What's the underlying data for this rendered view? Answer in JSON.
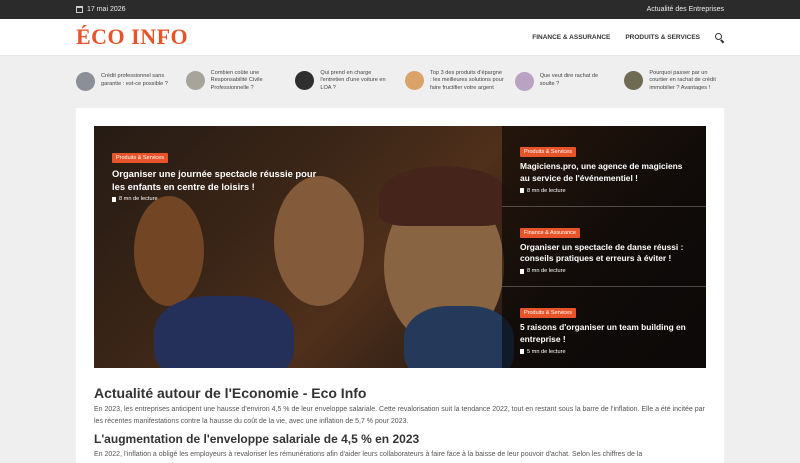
{
  "topbar": {
    "date": "17 mai 2026",
    "right_link": "Actualité des Entreprises"
  },
  "header": {
    "logo": "ÉCO INFO",
    "nav": [
      "FINANCE & ASSURANCE",
      "PRODUITS & SERVICES"
    ]
  },
  "ticker": [
    {
      "text": "Crédit professionnel sans garantie : est-ce possible ?",
      "color": "#8a8f98"
    },
    {
      "text": "Combien coûte une Responsabilité Civile Professionnelle ?",
      "color": "#a7a59b"
    },
    {
      "text": "Qui prend en charge l'entretien d'une voiture en LOA ?",
      "color": "#2f2f2f"
    },
    {
      "text": "Top 3 des produits d'épargne : les meilleures solutions pour faire fructifier votre argent",
      "color": "#d9a36a"
    },
    {
      "text": "Que veut dire rachat de soulte ?",
      "color": "#b9a2c2"
    },
    {
      "text": "Pourquoi passer par un courtier en rachat de crédit immobilier ? Avantages !",
      "color": "#6f6a52"
    }
  ],
  "hero": {
    "feature": {
      "category": "Produits & Services",
      "title": "Organiser une journée spectacle réussie pour les enfants en centre de loisirs !",
      "read": "8 mn de lecture"
    },
    "side": [
      {
        "category": "Produits & Services",
        "title": "Magiciens.pro, une agence de magiciens au service de l'événementiel !",
        "read": "8 mn de lecture"
      },
      {
        "category": "Finance & Assurance",
        "title": "Organiser un spectacle de danse réussi : conseils pratiques et erreurs à éviter !",
        "read": "8 mn de lecture"
      },
      {
        "category": "Produits & Services",
        "title": "5 raisons d'organiser un team building en entreprise !",
        "read": "5 mn de lecture"
      }
    ]
  },
  "article": {
    "h1": "Actualité autour de l'Economie - Eco Info",
    "p1": "En 2023, les entreprises anticipent une hausse d'environ 4,5 % de leur enveloppe salariale. Cette revalorisation suit la tendance 2022, tout en restant sous la barre de l'inflation. Elle a été incitée par les récentes manifestations contre la hausse du coût de la vie, avec une inflation de 5,7 % pour 2023.",
    "h2": "L'augmentation de l'enveloppe salariale de 4,5 % en 2023",
    "p2": "En 2022, l'inflation a obligé les employeurs à revaloriser les rémunérations afin d'aider leurs collaborateurs à faire face à la baisse de leur pouvoir d'achat. Selon les chiffres de la"
  }
}
